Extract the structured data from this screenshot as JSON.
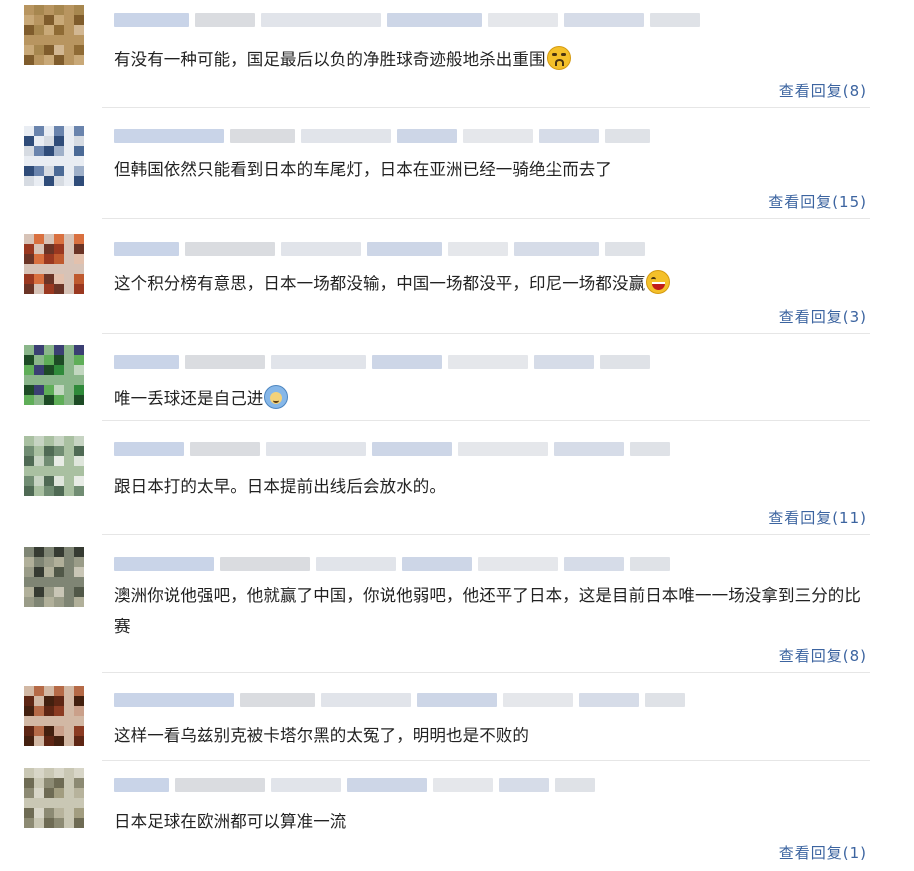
{
  "comments": [
    {
      "username": "",
      "text": "有没有一种可能，国足最后以负的净胜球奇迹般地杀出重围",
      "emoji": "cry-emoji",
      "reply": "查看回复(8)",
      "avatar": [
        "#b89560",
        "#8f6b35",
        "#c9a978",
        "#a7874f",
        "#7f5c2c",
        "#d2b792"
      ]
    },
    {
      "username": "",
      "text": "但韩国依然只能看到日本的车尾灯，日本在亚洲已经一骑绝尘而去了",
      "emoji": "",
      "reply": "查看回复(15)",
      "avatar": [
        "#e9edf3",
        "#9fb0c9",
        "#2f4c79",
        "#6a84ad",
        "#d6dbe2",
        "#4b6a96"
      ]
    },
    {
      "username": "",
      "text": "这个积分榜有意思，日本一场都没输，中国一场都没平，印尼一场都没赢",
      "emoji": "laugh-emoji",
      "reply": "查看回复(3)",
      "avatar": [
        "#d7c3b7",
        "#bf5a2f",
        "#9a3820",
        "#d9703f",
        "#6b3426",
        "#e3c1ad"
      ]
    },
    {
      "username": "",
      "text": "唯一丢球还是自己进",
      "emoji": "smile-emoji",
      "reply": "",
      "avatar": [
        "#8ab68a",
        "#2f8a3a",
        "#1d4b25",
        "#3b3f73",
        "#5fae58",
        "#c2d7c0"
      ]
    },
    {
      "username": "",
      "text": "跟日本打的太早。日本提前出线后会放水的。",
      "emoji": "",
      "reply": "查看回复(11)",
      "avatar": [
        "#a9c0a1",
        "#e8ece6",
        "#718d73",
        "#c7d4c3",
        "#4f6a54",
        "#dfe6dc"
      ]
    },
    {
      "username": "",
      "text": "澳洲你说他强吧，他就赢了中国，你说他弱吧，他还平了日本，这是目前日本唯一一场没拿到三分的比赛",
      "emoji": "",
      "reply": "查看回复(8)",
      "avatar": [
        "#7f8574",
        "#515848",
        "#b1b09a",
        "#363b32",
        "#9a9c88",
        "#c9c6b6"
      ]
    },
    {
      "username": "",
      "text": "这样一看乌兹别克被卡塔尔黑的太冤了，明明也是不败的",
      "emoji": "",
      "reply": "",
      "avatar": [
        "#d2b8a4",
        "#8b3b22",
        "#5e2614",
        "#b56a47",
        "#43200f",
        "#caa08a"
      ]
    },
    {
      "username": "",
      "text": "日本足球在欧洲都可以算准一流",
      "emoji": "",
      "reply": "查看回复(1)",
      "avatar": [
        "#c9c7b4",
        "#a29d80",
        "#6e6b54",
        "#d8d6c8",
        "#8c8a73",
        "#b7b39c"
      ]
    }
  ]
}
